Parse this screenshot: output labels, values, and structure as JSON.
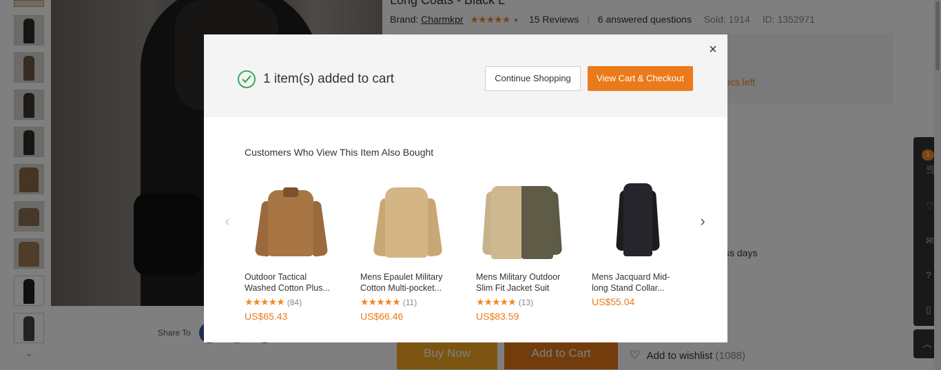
{
  "page": {
    "title": "Long Coats - Black L",
    "brand_label": "Brand:",
    "brand_name": "Charmkpr",
    "stars": "★★★★★",
    "reviews": "15 Reviews",
    "answered": "6 answered questions",
    "sold": "Sold: 1914",
    "id": "ID: 1352971",
    "pcs_left": "pcs left",
    "ship_text": "ss days",
    "share_label": "Share To",
    "buy_now": "Buy Now",
    "add_to_cart": "Add to Cart",
    "wishlist_label": "Add to wishlist",
    "wishlist_count": "(1088)",
    "cart_badge": "1"
  },
  "modal": {
    "added_text": "1 item(s) added to cart",
    "continue_label": "Continue Shopping",
    "checkout_label": "View Cart & Checkout",
    "close_glyph": "×",
    "rec_title": "Customers Who View This Item Also Bought",
    "prev_glyph": "‹",
    "next_glyph": "›",
    "products": [
      {
        "name": "Outdoor Tactical Washed Cotton Plus...",
        "stars": "★★★★★",
        "reviews": "(84)",
        "price": "US$65.43",
        "rating": 4.5
      },
      {
        "name": "Mens Epaulet Military Cotton Multi-pocket...",
        "stars": "★★★★★",
        "reviews": "(11)",
        "price": "US$66.46",
        "rating": 5
      },
      {
        "name": "Mens Military Outdoor Slim Fit Jacket Suit",
        "stars": "★★★★★",
        "reviews": "(13)",
        "price": "US$83.59",
        "rating": 4.5
      },
      {
        "name": "Mens Jacquard Mid-long Stand Collar...",
        "stars": "",
        "reviews": "",
        "price": "US$55.04",
        "rating": null
      }
    ]
  },
  "colors": {
    "accent_orange": "#ea7a1a",
    "star_orange": "#f08a24",
    "success_green": "#3aa757",
    "buy_now_yellow": "#f9a825"
  }
}
